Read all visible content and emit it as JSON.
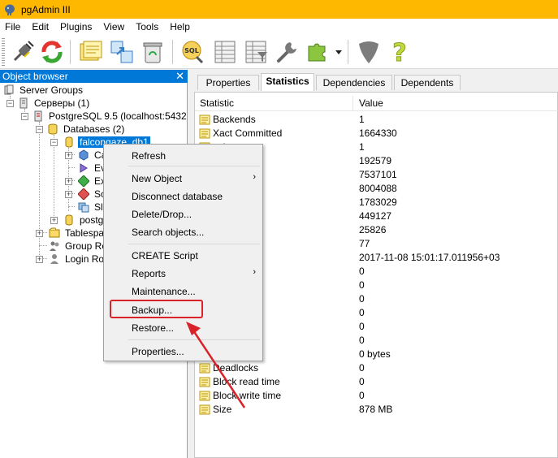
{
  "window": {
    "title": "pgAdmin III"
  },
  "menubar": {
    "items": [
      "File",
      "Edit",
      "Plugins",
      "View",
      "Tools",
      "Help"
    ]
  },
  "toolbar": {
    "buttons": [
      "connect-icon",
      "refresh-icon",
      "properties-icon",
      "create-icon",
      "drop-icon",
      "sql-icon",
      "view-data-icon",
      "filtered-data-icon",
      "maintenance-icon",
      "plugins-icon",
      "plugins-dropdown-icon",
      "guru-icon",
      "help-icon"
    ]
  },
  "object_browser": {
    "title": "Object browser",
    "close": "✕",
    "tree": {
      "server_groups": "Server Groups",
      "servers": "Серверы (1)",
      "server": "PostgreSQL 9.5 (localhost:5432)",
      "databases": "Databases (2)",
      "db_selected": "falcongaze_db1",
      "child_catalogs": "Ca",
      "child_event_triggers": "Ev",
      "child_extensions": "Ex",
      "child_schemas": "Sc",
      "child_slony": "Sl",
      "db_other": "postg",
      "tablespaces": "Tablespac",
      "group_roles": "Group Rol",
      "login_roles": "Login Role"
    },
    "expanders": {
      "minus": "−",
      "plus": "+"
    }
  },
  "tabs": [
    "Properties",
    "Statistics",
    "Dependencies",
    "Dependents"
  ],
  "active_tab": "Statistics",
  "stats": {
    "columns": [
      "Statistic",
      "Value"
    ],
    "rows": [
      {
        "name": "Backends",
        "value": "1"
      },
      {
        "name": "Xact Committed",
        "value": "1664330"
      },
      {
        "name": "ack",
        "value": "1"
      },
      {
        "name": "",
        "value": "192579"
      },
      {
        "name": "",
        "value": "7537101"
      },
      {
        "name": "ned",
        "value": "8004088"
      },
      {
        "name": "ed",
        "value": "1783029"
      },
      {
        "name": "ed",
        "value": "449127"
      },
      {
        "name": "ed",
        "value": "25826"
      },
      {
        "name": "d",
        "value": "77"
      },
      {
        "name": "reset",
        "value": "2017-11-08 15:01:17.011956+03"
      },
      {
        "name": "onflicts",
        "value": "0"
      },
      {
        "name": "",
        "value": "0"
      },
      {
        "name": "flicts",
        "value": "0"
      },
      {
        "name": "flicts",
        "value": "0"
      },
      {
        "name": "flicts",
        "value": "0"
      },
      {
        "name": "es",
        "value": "0"
      },
      {
        "name": "rary files",
        "value": "0 bytes"
      },
      {
        "name": "Deadlocks",
        "value": "0"
      },
      {
        "name": "Block read time",
        "value": "0"
      },
      {
        "name": "Block write time",
        "value": "0"
      },
      {
        "name": "Size",
        "value": "878 MB"
      }
    ]
  },
  "context_menu": {
    "refresh": "Refresh",
    "new_object": "New Object",
    "disconnect": "Disconnect database",
    "delete_drop": "Delete/Drop...",
    "search_objects": "Search objects...",
    "create_script": "CREATE Script",
    "reports": "Reports",
    "maintenance": "Maintenance...",
    "backup": "Backup...",
    "restore": "Restore...",
    "properties": "Properties...",
    "submenu_arrow": "›"
  },
  "colors": {
    "titlebar": "#ffb800",
    "selection": "#0078d7",
    "annotation": "#d9232b"
  }
}
